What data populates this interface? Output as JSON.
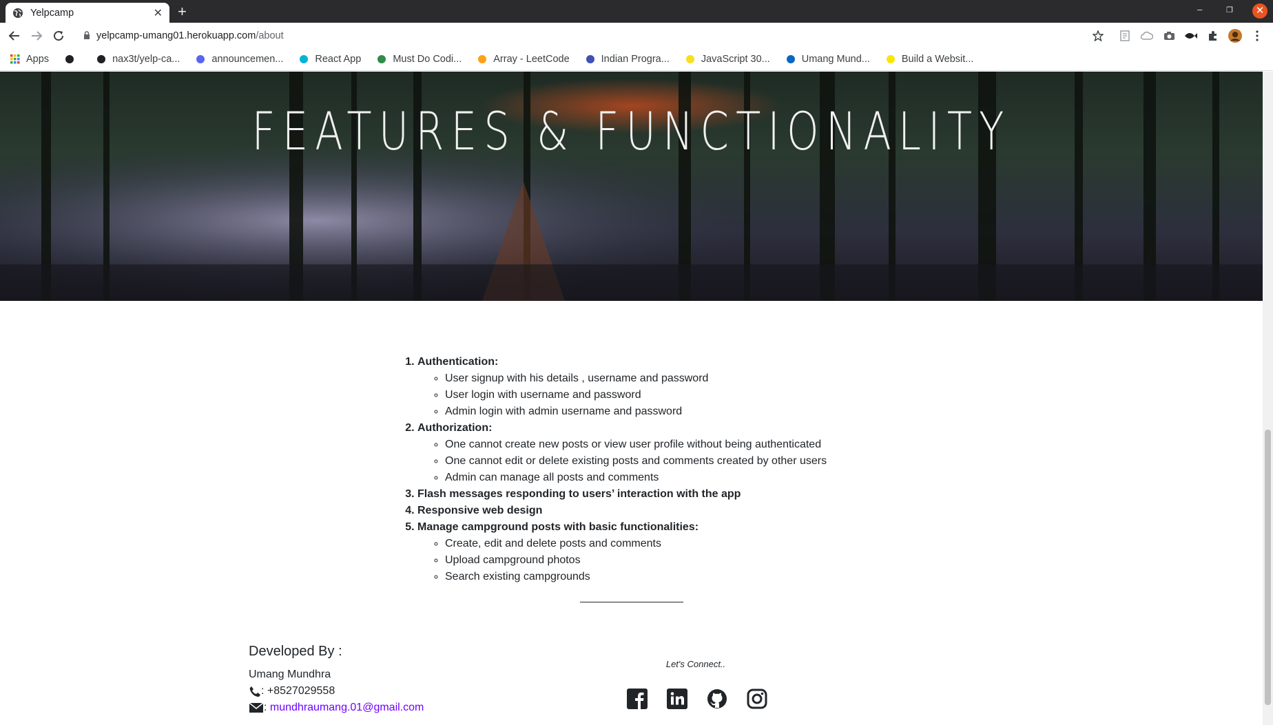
{
  "browser": {
    "tab_title": "Yelpcamp",
    "url_host": "yelpcamp-umang01.herokuapp.com",
    "url_path": "/about",
    "bookmarks": [
      {
        "label": "Apps",
        "icon": "apps-grid-icon",
        "color": "#ea4335"
      },
      {
        "label": "",
        "icon": "globe-icon",
        "color": "#202124"
      },
      {
        "label": "nax3t/yelp-ca...",
        "icon": "github-icon",
        "color": "#202124"
      },
      {
        "label": "announcemen...",
        "icon": "discord-icon",
        "color": "#5865f2"
      },
      {
        "label": "React App",
        "icon": "react-icon",
        "color": "#00b4d8"
      },
      {
        "label": "Must Do Codi...",
        "icon": "gfg-icon",
        "color": "#2f8d46"
      },
      {
        "label": "Array - LeetCode",
        "icon": "leetcode-icon",
        "color": "#ffa116"
      },
      {
        "label": "Indian Progra...",
        "icon": "trophy-icon",
        "color": "#3f51b5"
      },
      {
        "label": "JavaScript 30...",
        "icon": "js30-icon",
        "color": "#f7df1e"
      },
      {
        "label": "Umang Mund...",
        "icon": "linkedin-icon",
        "color": "#0a66c2"
      },
      {
        "label": "Build a Websit...",
        "icon": "website-icon",
        "color": "#f9e50a"
      }
    ]
  },
  "hero": {
    "title": "FEATURES & FUNCTIONALITY"
  },
  "features": [
    {
      "title": "Authentication:",
      "items": [
        "User signup with his details , username and password",
        "User login with username and password",
        "Admin login with admin username and password"
      ]
    },
    {
      "title": "Authorization:",
      "items": [
        "One cannot create new posts or view user profile without being authenticated",
        "One cannot edit or delete existing posts and comments created by other users",
        "Admin can manage all posts and comments"
      ]
    },
    {
      "title": "Flash messages responding to users’ interaction with the app",
      "items": []
    },
    {
      "title": "Responsive web design",
      "items": []
    },
    {
      "title": "Manage campground posts with basic functionalities:",
      "items": [
        "Create, edit and delete posts and comments",
        "Upload campground photos",
        "Search existing campgrounds"
      ]
    }
  ],
  "footer": {
    "developed_by": "Developed By :",
    "name": "Umang Mundhra",
    "phone": ": +8527029558",
    "email_prefix": ": ",
    "email": "mundhraumang.01@gmail.com",
    "connect_label": "Let's Connect..",
    "socials": [
      "facebook-icon",
      "linkedin-icon",
      "github-icon",
      "instagram-icon"
    ]
  },
  "colors": {
    "link": "#6f00ff",
    "close_button": "#e95420",
    "titlebar": "#2b2b2e"
  }
}
